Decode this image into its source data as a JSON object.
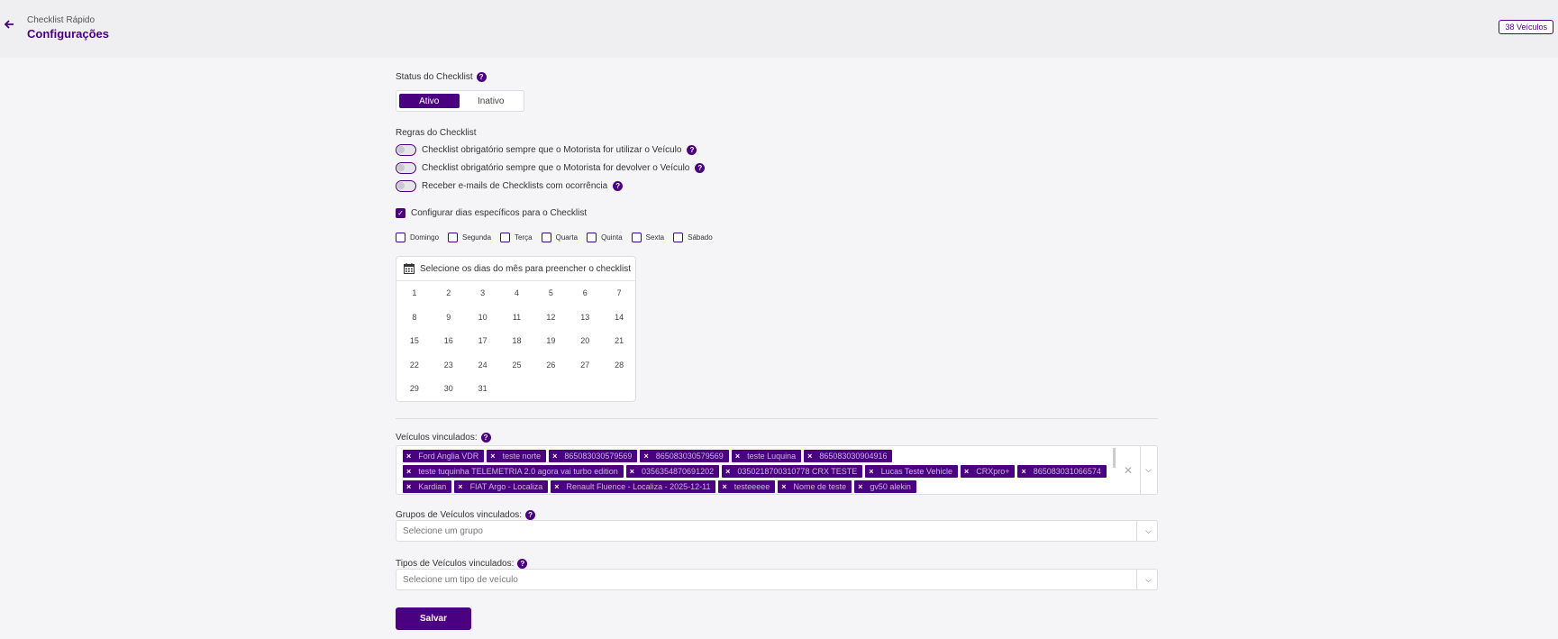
{
  "header": {
    "breadcrumb": "Checklist Rápido",
    "title": "Configurações",
    "vehicles_badge": "38 Veículos"
  },
  "status": {
    "label": "Status do Checklist",
    "options": [
      "Ativo",
      "Inativo"
    ],
    "selected": "Ativo"
  },
  "rules": {
    "label": "Regras do Checklist",
    "items": [
      "Checklist obrigatório sempre que o Motorista for utilizar o Veículo",
      "Checklist obrigatório sempre que o Motorista for devolver o Veículo",
      "Receber e-mails de Checklists com ocorrência"
    ]
  },
  "specific_days": {
    "label": "Configurar dias específicos para o Checklist",
    "checked": true,
    "weekdays": [
      "Domingo",
      "Segunda",
      "Terça",
      "Quarta",
      "Quinta",
      "Sexta",
      "Sábado"
    ]
  },
  "calendar": {
    "title": "Selecione os dias do mês para preencher o checklist",
    "days": [
      "1",
      "2",
      "3",
      "4",
      "5",
      "6",
      "7",
      "8",
      "9",
      "10",
      "11",
      "12",
      "13",
      "14",
      "15",
      "16",
      "17",
      "18",
      "19",
      "20",
      "21",
      "22",
      "23",
      "24",
      "25",
      "26",
      "27",
      "28",
      "29",
      "30",
      "31"
    ]
  },
  "vehicles": {
    "label": "Veículos vinculados:",
    "chips": [
      "Ford Anglia VDR",
      "teste norte",
      "865083030579569",
      "865083030579569",
      "teste Luquina",
      "865083030904916",
      "teste tuquinha TELEMETRIA 2.0 agora vai turbo edition",
      "0356354870691202",
      "0350218700310778 CRX TESTE",
      "Lucas Teste Vehicle",
      "CRXpro+",
      "865083031066574",
      "Kardian",
      "FIAT Argo - Localiza",
      "Renault Fluence - Localiza - 2025-12-11",
      "testeeeee",
      "Nome de teste",
      "gv50 alekin"
    ]
  },
  "groups": {
    "label": "Grupos de Veículos vinculados:",
    "placeholder": "Selecione um grupo"
  },
  "types": {
    "label": "Tipos de Veículos vinculados:",
    "placeholder": "Selecione um tipo de veículo"
  },
  "save_label": "Salvar",
  "colors": {
    "accent": "#4b0082",
    "background": "#f5f5f7"
  }
}
